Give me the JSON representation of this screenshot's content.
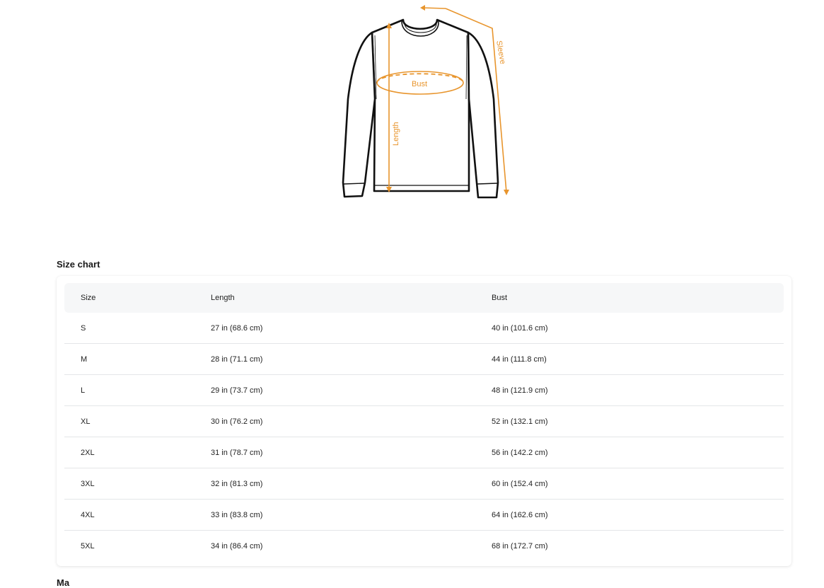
{
  "diagram": {
    "labels": {
      "bust": "Bust",
      "length": "Length",
      "sleeve": "Sleeve"
    },
    "accent_color": "#e8952d",
    "outline_color": "#111111"
  },
  "size_chart": {
    "title": "Size chart",
    "headers": {
      "size": "Size",
      "length": "Length",
      "bust": "Bust"
    },
    "rows": [
      {
        "size": "S",
        "length": "27 in  (68.6 cm)",
        "bust": "40 in  (101.6 cm)"
      },
      {
        "size": "M",
        "length": "28 in  (71.1 cm)",
        "bust": "44 in  (111.8 cm)"
      },
      {
        "size": "L",
        "length": "29 in  (73.7 cm)",
        "bust": "48 in  (121.9 cm)"
      },
      {
        "size": "XL",
        "length": "30 in  (76.2 cm)",
        "bust": "52 in  (132.1 cm)"
      },
      {
        "size": "2XL",
        "length": "31 in  (78.7 cm)",
        "bust": "56 in  (142.2 cm)"
      },
      {
        "size": "3XL",
        "length": "32 in  (81.3 cm)",
        "bust": "60 in  (152.4 cm)"
      },
      {
        "size": "4XL",
        "length": "33 in  (83.8 cm)",
        "bust": "64 in  (162.6 cm)"
      },
      {
        "size": "5XL",
        "length": "34 in  (86.4 cm)",
        "bust": "68 in  (172.7 cm)"
      }
    ]
  },
  "footer": {
    "partial_heading": "Ma"
  }
}
